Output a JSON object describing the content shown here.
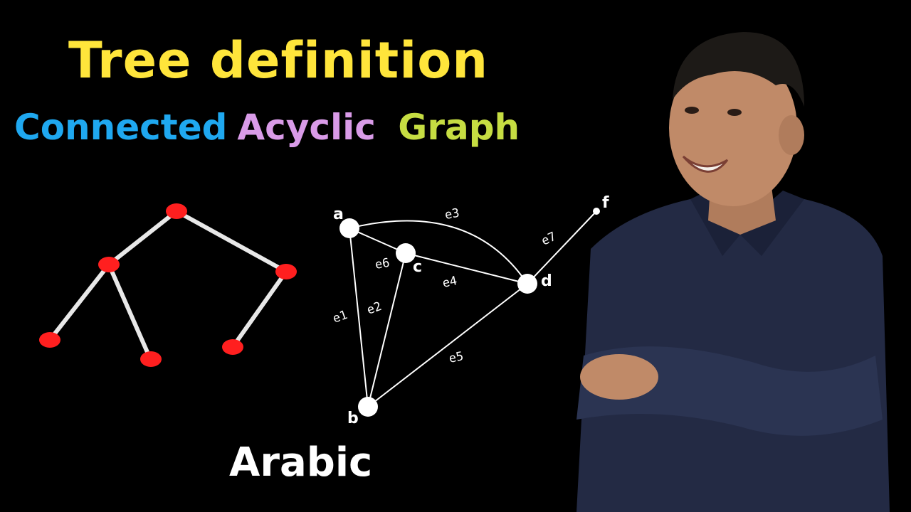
{
  "title": "Tree definition",
  "subtitle": {
    "word1": "Connected",
    "word2": "Acyclic",
    "word3": "Graph"
  },
  "footer": "Arabic",
  "graph": {
    "node_labels": {
      "a": "a",
      "b": "b",
      "c": "c",
      "d": "d",
      "f": "f"
    },
    "edge_labels": {
      "e1": "e1",
      "e2": "e2",
      "e3": "e3",
      "e4": "e4",
      "e5": "e5",
      "e6": "e6",
      "e7": "e7"
    }
  },
  "colors": {
    "background": "#000000",
    "title": "#FFE53B",
    "connected": "#1FA8F0",
    "acyclic": "#D99BE8",
    "graph": "#C6DD42",
    "footer": "#FFFFFF",
    "tree_node": "#FF1F1F",
    "tree_edge": "#E8E8E8",
    "graph_line": "#FFFFFF"
  },
  "presenter": {
    "shirt_color": "#232a44",
    "skin_color": "#c08a68",
    "hair_color": "#1d1a17"
  }
}
